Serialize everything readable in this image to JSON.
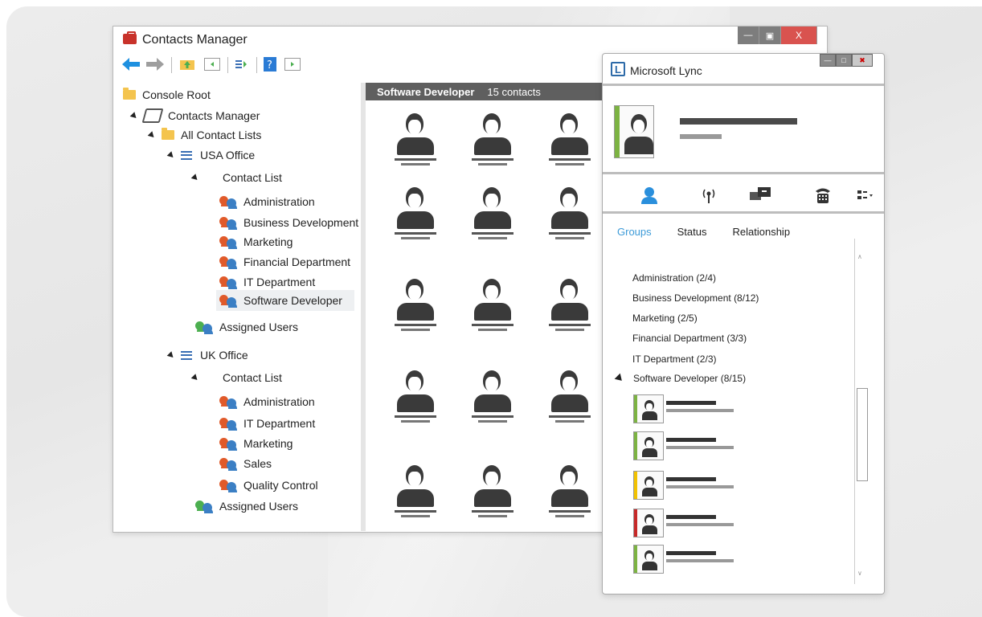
{
  "contacts_manager": {
    "title": "Contacts Manager",
    "close_label": "X",
    "tree": {
      "console_root": "Console Root",
      "contacts_manager": "Contacts Manager",
      "all_contact_lists": "All Contact Lists",
      "usa_office": "USA Office",
      "usa_contact_list": "Contact List",
      "usa_groups": [
        "Administration",
        "Business Development",
        "Marketing",
        "Financial Department",
        "IT Department",
        "Software Developer"
      ],
      "usa_assigned": "Assigned Users",
      "uk_office": "UK Office",
      "uk_contact_list": "Contact List",
      "uk_groups": [
        "Administration",
        "IT Department",
        "Marketing",
        "Sales",
        "Quality Control"
      ],
      "uk_assigned": "Assigned Users"
    },
    "grid": {
      "heading": "Software Developer",
      "count": "15 contacts"
    }
  },
  "lync": {
    "title": "Microsoft Lync",
    "tabs": {
      "groups": "Groups",
      "status": "Status",
      "relationship": "Relationship"
    },
    "groups": [
      {
        "label": "Administration (2/4)",
        "expanded": false
      },
      {
        "label": "Business Development (8/12)",
        "expanded": false
      },
      {
        "label": "Marketing (2/5)",
        "expanded": false
      },
      {
        "label": "Financial Department (3/3)",
        "expanded": false
      },
      {
        "label": "IT Department (2/3)",
        "expanded": false
      },
      {
        "label": "Software Developer (8/15)",
        "expanded": true
      }
    ],
    "member_status_colors": [
      "#7cb342",
      "#7cb342",
      "#f2c200",
      "#c62828",
      "#7cb342"
    ],
    "accent_color": "#3d9bd8"
  }
}
